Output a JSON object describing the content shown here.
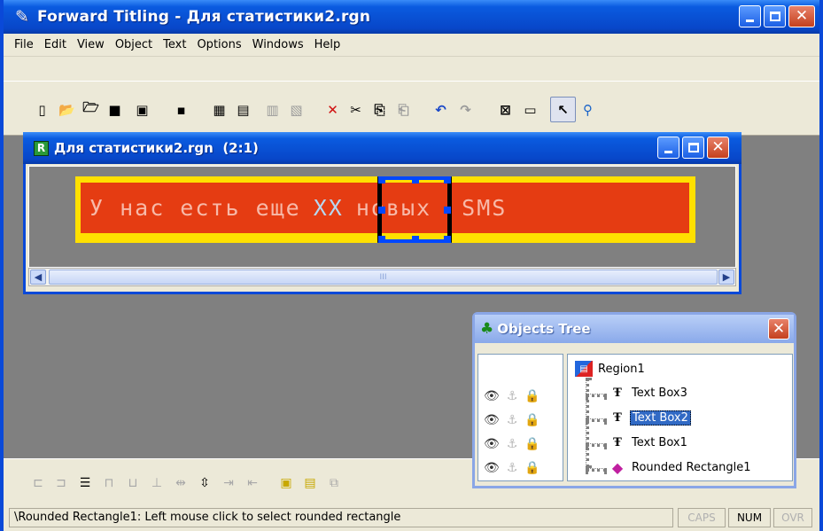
{
  "app": {
    "title": "Forward Titling - Для статистики2.rgn",
    "icon": "feather-pen-icon",
    "accent": "#0a5be0"
  },
  "menu": [
    "File",
    "Edit",
    "View",
    "Object",
    "Text",
    "Options",
    "Windows",
    "Help"
  ],
  "toolbar": [
    {
      "name": "new-doc",
      "glyph": "▯"
    },
    {
      "name": "open",
      "glyph": "📂"
    },
    {
      "name": "open-template",
      "glyph": "🗁"
    },
    {
      "name": "save",
      "glyph": "■"
    },
    {
      "name": "save-all",
      "glyph": "▣"
    },
    {
      "name": "save-as",
      "glyph": "▪"
    },
    {
      "name": "import-image",
      "glyph": "▦"
    },
    {
      "name": "import-sequence",
      "glyph": "▤"
    },
    {
      "name": "export",
      "glyph": "▥"
    },
    {
      "name": "export-all",
      "glyph": "▧"
    },
    {
      "name": "delete",
      "glyph": "✕"
    },
    {
      "name": "cut",
      "glyph": "✂"
    },
    {
      "name": "copy",
      "glyph": "⎘"
    },
    {
      "name": "paste",
      "glyph": "⎗"
    },
    {
      "name": "undo",
      "glyph": "↶"
    },
    {
      "name": "redo",
      "glyph": "↷"
    },
    {
      "name": "stop-preview",
      "glyph": "⊠"
    },
    {
      "name": "preview",
      "glyph": "▭"
    },
    {
      "name": "select-tool",
      "glyph": "↖"
    },
    {
      "name": "zoom-tool",
      "glyph": "⚲"
    }
  ],
  "document": {
    "title": "Для статистики2.rgn",
    "zoom": "(2:1)",
    "icon_letter": "R",
    "banner_text_before": "У нас есть еще",
    "banner_text_sel": "XX",
    "banner_text_after": "новых  SMS",
    "banner_yellow": "#ffe000",
    "banner_red": "#e53c12",
    "scroll_thumb": "III"
  },
  "objects_tree": {
    "title": "Objects Tree",
    "root": "Region1",
    "children": [
      {
        "label": "Text Box3",
        "icon": "text-box-icon",
        "selected": false
      },
      {
        "label": "Text Box2",
        "icon": "text-box-icon",
        "selected": true
      },
      {
        "label": "Text Box1",
        "icon": "text-box-icon",
        "selected": false
      },
      {
        "label": "Rounded Rectangle1",
        "icon": "rounded-rectangle-icon",
        "selected": false
      }
    ]
  },
  "status": {
    "message": "\\Rounded Rectangle1: Left mouse click to select rounded rectangle",
    "caps": "CAPS",
    "num": "NUM",
    "ovr": "OVR"
  }
}
